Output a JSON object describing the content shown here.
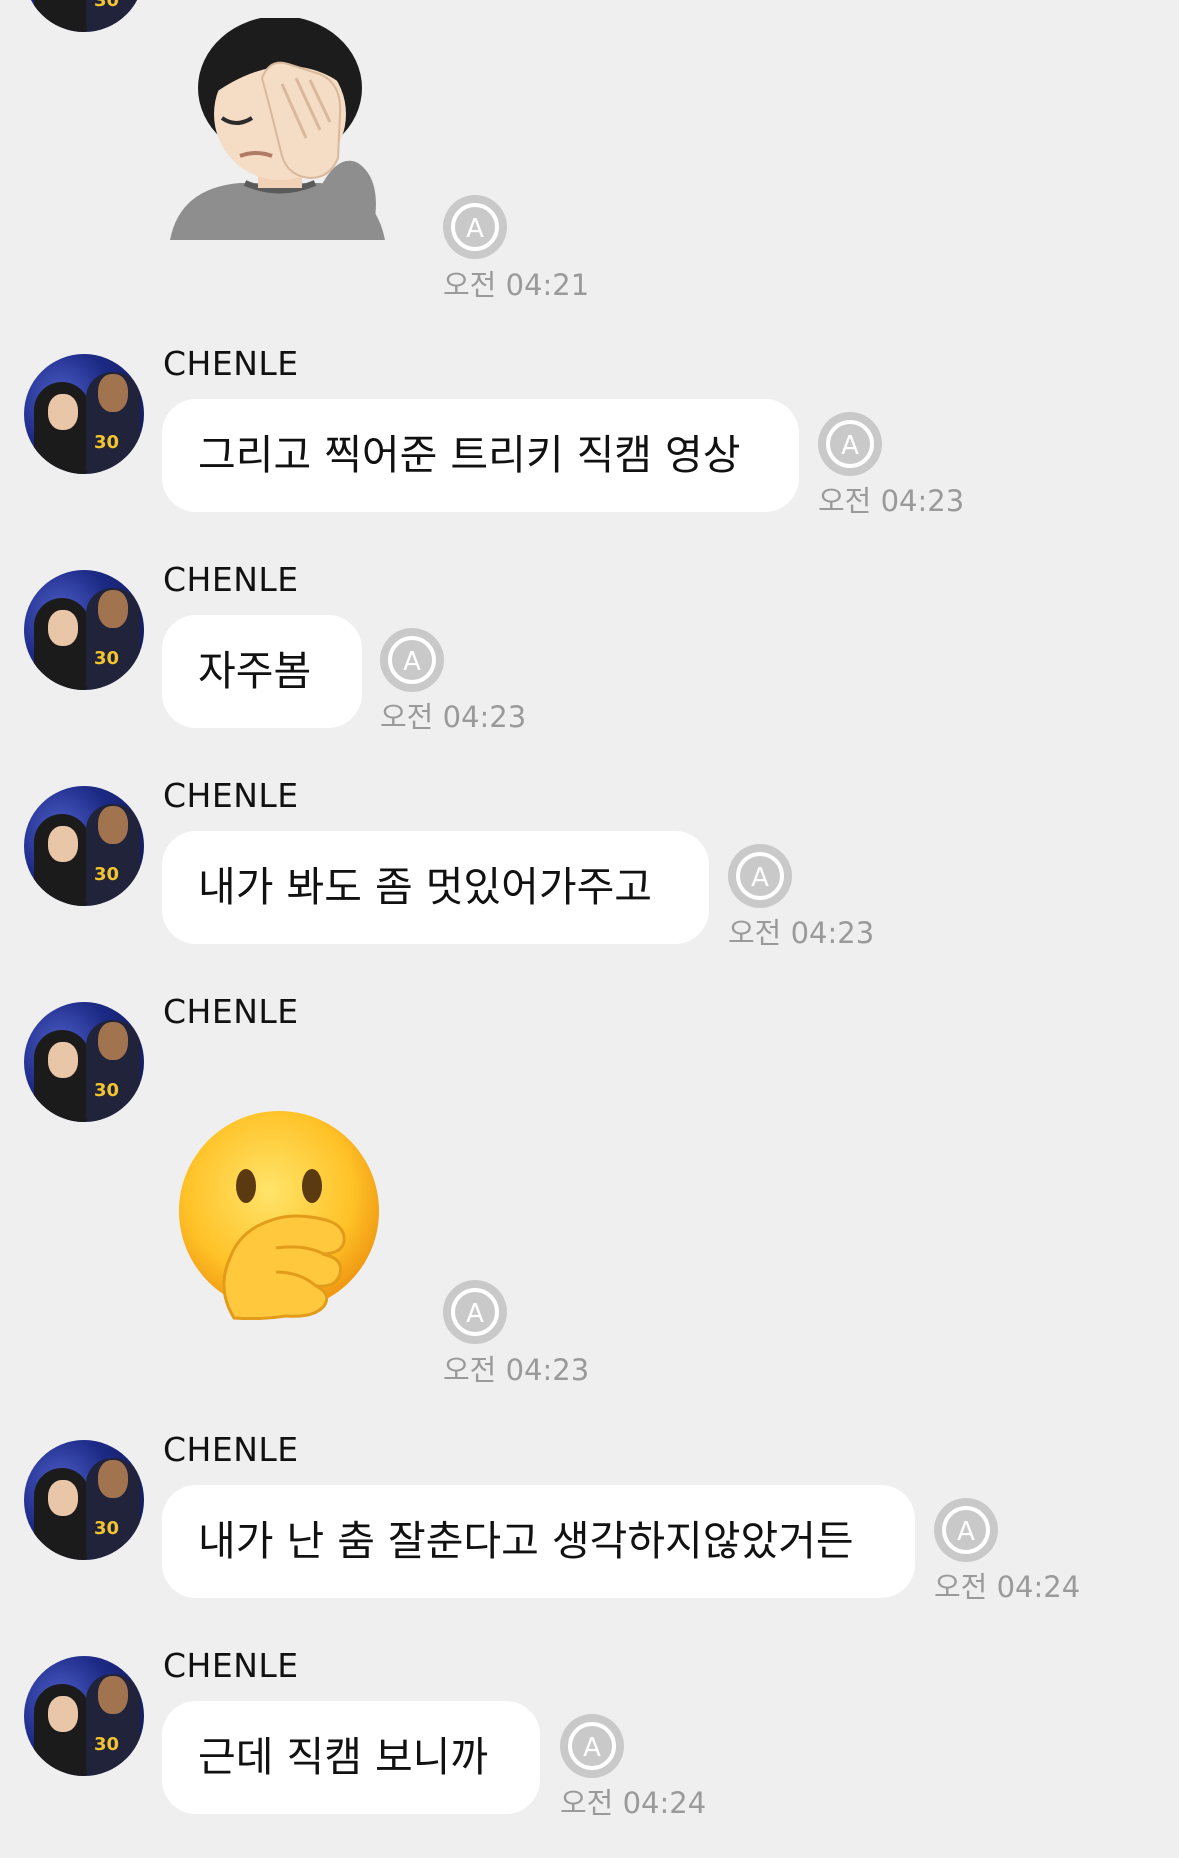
{
  "messages": [
    {
      "type": "sticker",
      "sticker": "facepalm-emoji",
      "time": "오전 04:21"
    },
    {
      "type": "text",
      "sender": "CHENLE",
      "text": "그리고 찍어준 트리키 직캠 영상",
      "time": "오전 04:23"
    },
    {
      "type": "text",
      "sender": "CHENLE",
      "text": "자주봄",
      "time": "오전 04:23"
    },
    {
      "type": "text",
      "sender": "CHENLE",
      "text": "내가 봐도 좀 멋있어가주고",
      "time": "오전 04:23"
    },
    {
      "type": "sticker",
      "sender": "CHENLE",
      "sticker": "face-with-hand-over-mouth-emoji",
      "time": "오전 04:23"
    },
    {
      "type": "text",
      "sender": "CHENLE",
      "text": "내가 난 춤 잘춘다고 생각하지않았거든",
      "time": "오전 04:24"
    },
    {
      "type": "text",
      "sender": "CHENLE",
      "text": "근데 직캠 보니까",
      "time": "오전 04:24"
    }
  ],
  "icons": {
    "translate": "translate-a-icon"
  },
  "colors": {
    "background": "#efefef",
    "bubble": "#ffffff",
    "time_text": "#9a9a9a",
    "icon_bg": "#c9c9c9"
  }
}
